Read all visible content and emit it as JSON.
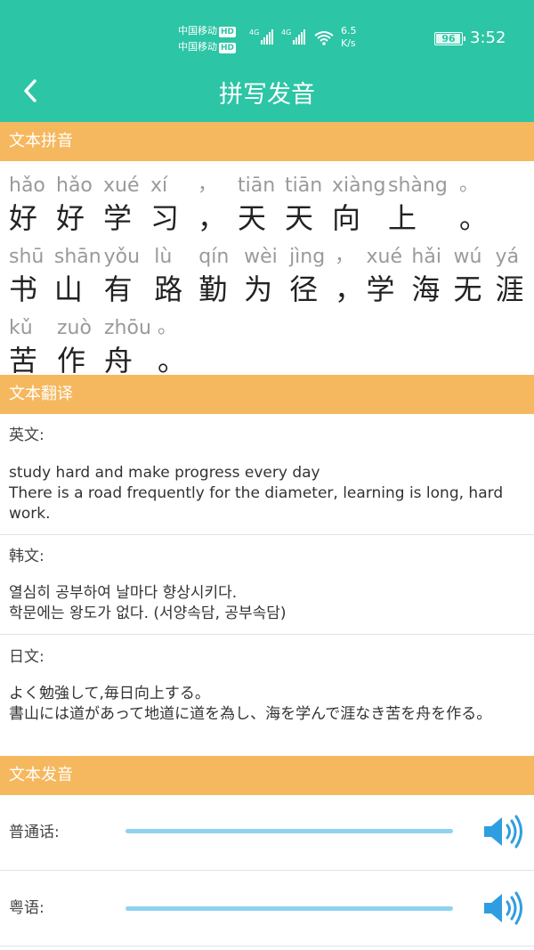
{
  "status_bar": {
    "carrier1": "中国移动",
    "carrier2": "中国移动",
    "hd": "HD",
    "net1": "4G",
    "net2": "4G",
    "speed_value": "6.5",
    "speed_unit": "K/s",
    "battery": "96",
    "battery_level": 0.96,
    "time": "3:52"
  },
  "nav": {
    "title": "拼写发音",
    "back_icon": "chevron-left-icon"
  },
  "sections": {
    "pinyin_header": "文本拼音",
    "translation_header": "文本翻译",
    "audio_header": "文本发音"
  },
  "pinyin_lines": [
    {
      "pinyin": [
        "hǎo",
        "hǎo",
        "xué",
        "xí",
        "，",
        "tiān",
        "tiān",
        "xiàng",
        "shàng",
        "。"
      ],
      "hanzi": [
        "好",
        "好",
        "学",
        "习",
        "，",
        "天",
        "天",
        "向",
        "上",
        "。"
      ]
    },
    {
      "pinyin": [
        "shū",
        "shān",
        "yǒu",
        "lù",
        "qín",
        "wèi",
        "jìng",
        "，",
        "xué",
        "hǎi",
        "wú",
        "yá"
      ],
      "hanzi": [
        "书",
        "山",
        "有",
        "路",
        "勤",
        "为",
        "径",
        "，",
        "学",
        "海",
        "无",
        "涯"
      ]
    },
    {
      "pinyin": [
        "kǔ",
        "zuò",
        "zhōu",
        "。"
      ],
      "hanzi": [
        "苦",
        "作",
        "舟",
        "。"
      ]
    }
  ],
  "translations": {
    "english": {
      "label": "英文:",
      "line1": "study hard and make progress every day",
      "line2": "There is a road frequently for the diameter, learning is long, hard work."
    },
    "korean": {
      "label": "韩文:",
      "line1": "열심히 공부하여 날마다 향상시키다.",
      "line2": "학문에는 왕도가 없다. (서양속담, 공부속담)"
    },
    "japanese": {
      "label": "日文:",
      "line1": "よく勉強して,毎日向上する。",
      "line2": "書山には道があって地道に道を為し、海を学んで涯なき苦を舟を作る。"
    }
  },
  "audio": {
    "mandarin_label": "普通话:",
    "cantonese_label": "粤语:",
    "speaker_icon": "speaker-icon",
    "track_color": "#8fd2f2"
  },
  "colors": {
    "primary": "#2cc5a5",
    "section": "#f6b85e"
  }
}
